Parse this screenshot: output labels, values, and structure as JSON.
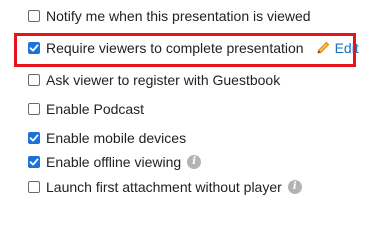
{
  "options": [
    {
      "label": "Notify me when this presentation is viewed",
      "checked": false
    },
    {
      "label": "Require viewers to complete presentation",
      "checked": true
    },
    {
      "label": "Ask viewer to register with Guestbook",
      "checked": false
    },
    {
      "label": "Enable Podcast",
      "checked": false
    },
    {
      "label": "Enable mobile devices",
      "checked": true
    },
    {
      "label": "Enable offline viewing",
      "checked": true
    },
    {
      "label": "Launch first attachment without player",
      "checked": false
    }
  ],
  "edit_label": "Edit",
  "info_glyph": "i",
  "colors": {
    "checkbox_checked": "#1a73d9",
    "highlight_border": "#e8121d",
    "edit_link": "#1b6fc2",
    "pencil": "#e8a317"
  }
}
